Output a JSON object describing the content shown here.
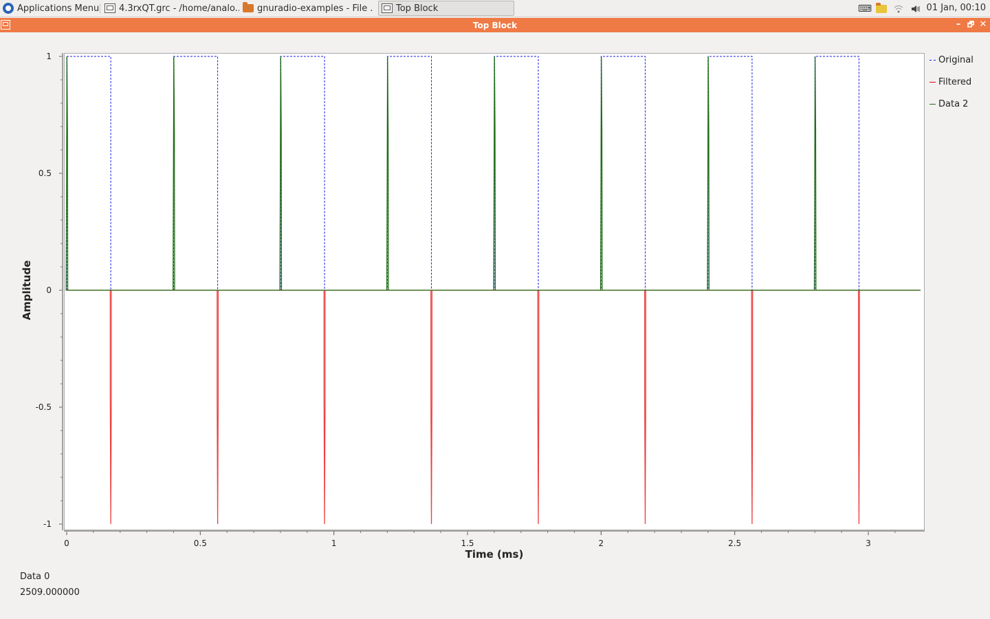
{
  "taskbar": {
    "apps_menu_label": "Applications Menu",
    "tasks": [
      {
        "label": "4.3rxQT.grc - /home/analo...",
        "icon": "window-icon"
      },
      {
        "label": "gnuradio-examples - File ...",
        "icon": "folder-icon"
      },
      {
        "label": "Top Block",
        "icon": "window-icon",
        "active": true
      }
    ],
    "tray_icons": [
      "keyboard-icon",
      "folder-icon",
      "wifi-icon",
      "volume-icon"
    ],
    "clock": "01 Jan, 00:10"
  },
  "window": {
    "title": "Top Block",
    "controls": {
      "minimize": "–",
      "maximize": "🗗",
      "close": "✕"
    }
  },
  "chart_data": {
    "type": "line",
    "title": "",
    "xlabel": "Time (ms)",
    "ylabel": "Amplitude",
    "xlim": [
      -0.01,
      3.2
    ],
    "ylim": [
      -1.02,
      1.02
    ],
    "x_ticks": [
      "0",
      "0.5",
      "1",
      "1.5",
      "2",
      "2.5",
      "3"
    ],
    "y_ticks": [
      "1",
      "0.5",
      "0",
      "-0.5",
      "-1"
    ],
    "period_ms": 0.4,
    "pulse_starts_ms": [
      0.0,
      0.4,
      0.8,
      1.2,
      1.6,
      2.0,
      2.4,
      2.8
    ],
    "pulse_width_ms": 0.165,
    "grid": false,
    "legend_position": "right",
    "series": [
      {
        "name": "Original",
        "color": "#1a1ae6",
        "style": "dashed",
        "description_values": "square pulse 0→1 for 0.165 ms every 0.4 ms"
      },
      {
        "name": "Filtered",
        "color": "#e60000",
        "style": "solid",
        "description_values": "spike to -1 at each falling edge of Original"
      },
      {
        "name": "Data 2",
        "color": "#1f6e14",
        "style": "solid",
        "description_values": "spike to +1 at each rising edge of Original"
      }
    ]
  },
  "status": {
    "label": "Data 0",
    "value": "2509.000000"
  }
}
